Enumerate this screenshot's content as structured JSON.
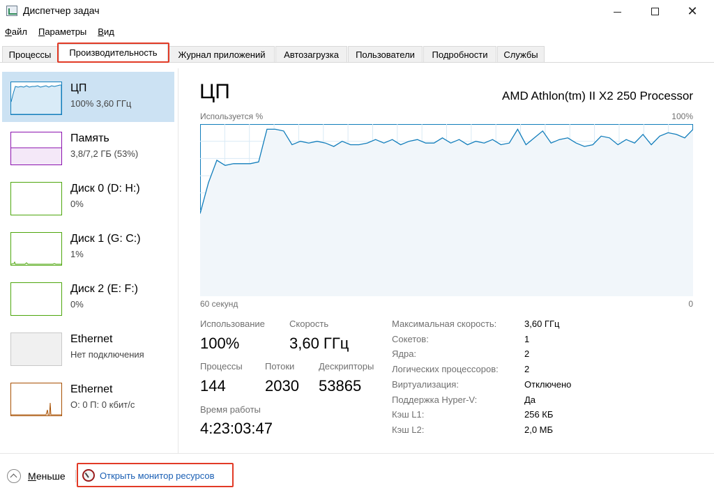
{
  "window": {
    "title": "Диспетчер задач",
    "controls": {
      "minimize": "—",
      "maximize": "□",
      "close": "✕"
    }
  },
  "menu": [
    "Файл",
    "Параметры",
    "Вид"
  ],
  "tabs": [
    "Процессы",
    "Производительность",
    "Журнал приложений",
    "Автозагрузка",
    "Пользователи",
    "Подробности",
    "Службы"
  ],
  "active_tab": "Производительность",
  "sidebar": [
    {
      "name": "ЦП",
      "sub": "100%  3,60 ГГц",
      "color": "#117dbb",
      "selected": true
    },
    {
      "name": "Память",
      "sub": "3,8/7,2 ГБ (53%)",
      "color": "#8b12ae"
    },
    {
      "name": "Диск 0 (D: H:)",
      "sub": "0%",
      "color": "#4da60c"
    },
    {
      "name": "Диск 1 (G: C:)",
      "sub": "1%",
      "color": "#4da60c"
    },
    {
      "name": "Диск 2 (E: F:)",
      "sub": "0%",
      "color": "#4da60c"
    },
    {
      "name": "Ethernet",
      "sub": "Нет подключения",
      "color": "#c8c8c8"
    },
    {
      "name": "Ethernet",
      "sub": "О: 0 П: 0 кбит/с",
      "color": "#a74f01"
    }
  ],
  "main": {
    "title": "ЦП",
    "processor": "AMD Athlon(tm) II X2 250 Processor",
    "graph_label": "Используется %",
    "graph_max": "100%",
    "graph_time": "60 секунд",
    "graph_zero": "0",
    "graph_color": "#117dbb",
    "cpu_usage_series": [
      48,
      66,
      79,
      76,
      77,
      77,
      77,
      78,
      97,
      97,
      96,
      88,
      90,
      89,
      90,
      89,
      87,
      90,
      88,
      88,
      89,
      91,
      89,
      91,
      88,
      90,
      91,
      89,
      89,
      92,
      89,
      91,
      88,
      90,
      89,
      91,
      88,
      89,
      97,
      88,
      92,
      96,
      89,
      91,
      92,
      89,
      87,
      88,
      93,
      92,
      88,
      91,
      89,
      94,
      88,
      93,
      95,
      94,
      92,
      97
    ],
    "stats": {
      "usage_label": "Использование",
      "usage_value": "100%",
      "speed_label": "Скорость",
      "speed_value": "3,60 ГГц",
      "processes_label": "Процессы",
      "processes_value": "144",
      "threads_label": "Потоки",
      "threads_value": "2030",
      "handles_label": "Дескрипторы",
      "handles_value": "53865",
      "uptime_label": "Время работы",
      "uptime_value": "4:23:03:47"
    },
    "details": [
      {
        "key": "Максимальная скорость:",
        "value": "3,60 ГГц"
      },
      {
        "key": "Сокетов:",
        "value": "1"
      },
      {
        "key": "Ядра:",
        "value": "2"
      },
      {
        "key": "Логических процессоров:",
        "value": "2"
      },
      {
        "key": "Виртуализация:",
        "value": "Отключено"
      },
      {
        "key": "Поддержка Hyper-V:",
        "value": "Да"
      },
      {
        "key": "Кэш L1:",
        "value": "256 КБ"
      },
      {
        "key": "Кэш L2:",
        "value": "2,0 МБ"
      }
    ]
  },
  "footer": {
    "less": "Меньше",
    "monitor_link": "Открыть монитор ресурсов"
  },
  "highlight_color": "#e23a26"
}
